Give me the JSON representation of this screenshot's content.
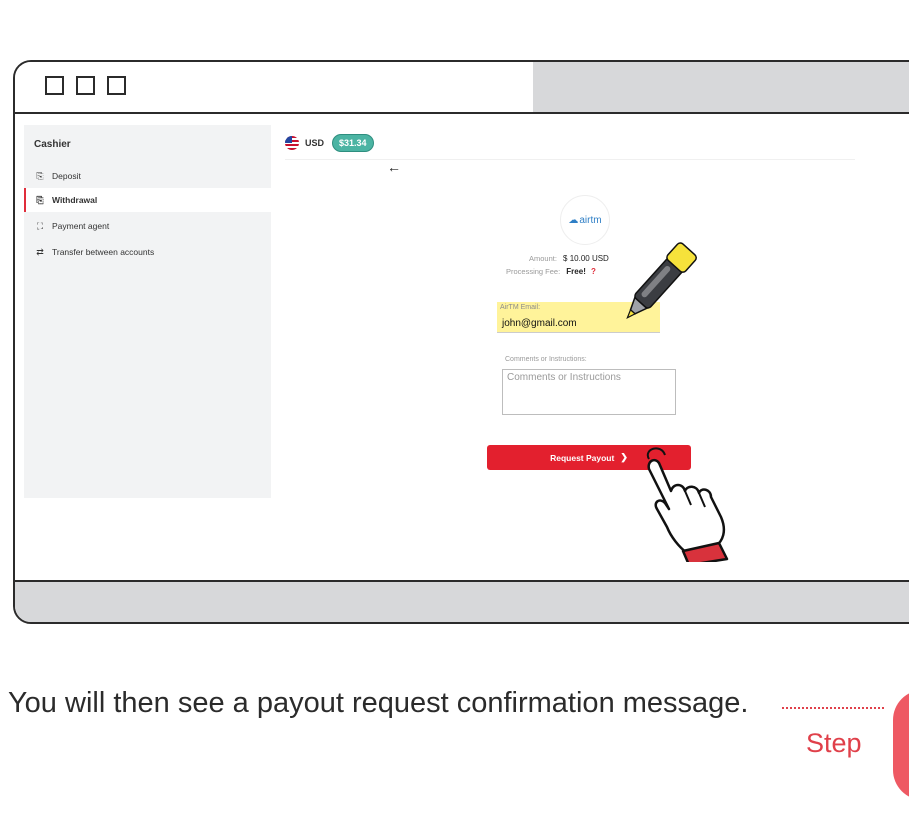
{
  "sidebar": {
    "title": "Cashier",
    "items": [
      {
        "label": "Deposit",
        "icon": "deposit-icon",
        "glyph": "⎘"
      },
      {
        "label": "Withdrawal",
        "icon": "withdrawal-icon",
        "glyph": "⎘"
      },
      {
        "label": "Payment agent",
        "icon": "payment-agent-icon",
        "glyph": "⛶"
      },
      {
        "label": "Transfer between accounts",
        "icon": "transfer-icon",
        "glyph": "⇄"
      }
    ],
    "active_index": 1
  },
  "account": {
    "currency": "USD",
    "balance": "$31.34"
  },
  "provider": {
    "logo_text": "airtm"
  },
  "details": {
    "amount_label": "Amount:",
    "amount_value": "$ 10.00 USD",
    "fee_label": "Processing Fee:",
    "fee_value": "Free!",
    "fee_help": "?"
  },
  "form": {
    "email_label": "AirTM Email:",
    "email_value": "john@gmail.com",
    "comments_label": "Comments or Instructions:",
    "comments_placeholder": "Comments or Instructions",
    "submit_label": "Request Payout"
  },
  "caption": {
    "text": "You will then see a payout request confirmation message.",
    "step_label": "Step"
  },
  "colors": {
    "accent_red": "#e3202e",
    "balance_green": "#4bb4a3",
    "highlight_yellow": "#fff39a",
    "airtm_blue": "#2f7fc6"
  }
}
